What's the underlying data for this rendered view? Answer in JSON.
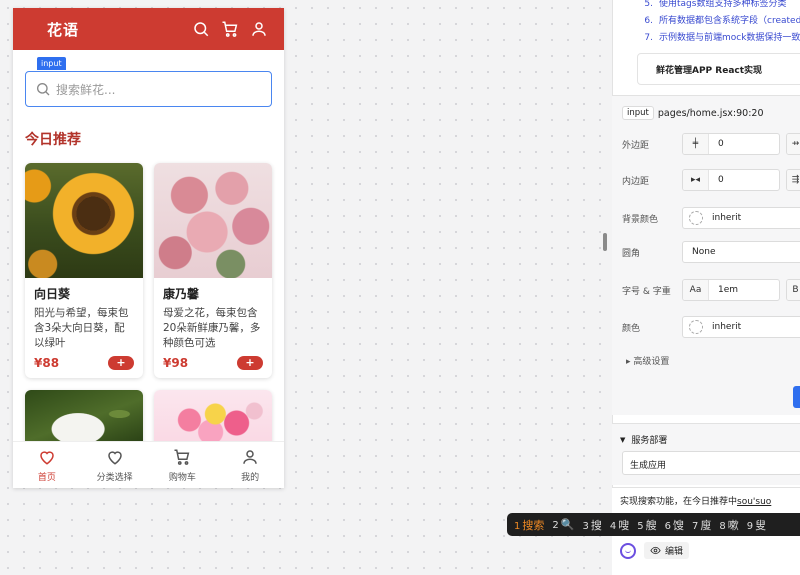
{
  "phone": {
    "app_title": "花语",
    "search": {
      "tag": "input",
      "placeholder": "搜索鲜花..."
    },
    "section_title": "今日推荐",
    "products": [
      {
        "name": "向日葵",
        "desc": "阳光与希望，每束包含3朵大向日葵，配以绿叶",
        "price": "¥88",
        "add": "+"
      },
      {
        "name": "康乃馨",
        "desc": "母爱之花，每束包含20朵新鲜康乃馨，多种颜色可选",
        "price": "¥98",
        "add": "+"
      }
    ],
    "tabs": [
      {
        "label": "首页",
        "icon": "heart-icon",
        "active": true
      },
      {
        "label": "分类选择",
        "icon": "heart-outline-icon",
        "active": false
      },
      {
        "label": "购物车",
        "icon": "cart-icon",
        "active": false
      },
      {
        "label": "我的",
        "icon": "user-icon",
        "active": false
      }
    ]
  },
  "chat": {
    "lines": [
      {
        "num": "5.",
        "text": "使用tags数组支持多种标签分类"
      },
      {
        "num": "6.",
        "text": "所有数据都包含系统字段（createdA"
      },
      {
        "num": "7.",
        "text": "示例数据与前端mock数据保持一致，"
      }
    ],
    "card_title": "鲜花管理APP React实现"
  },
  "properties": {
    "element_tag": "input",
    "element_path": "pages/home.jsx:90:20",
    "margin": {
      "label": "外边距",
      "value": "0"
    },
    "padding": {
      "label": "内边距",
      "value": "0"
    },
    "background": {
      "label": "背景颜色",
      "value": "inherit"
    },
    "radius": {
      "label": "圆角",
      "value": "None"
    },
    "font": {
      "label": "字号 & 字重",
      "icon_text": "Aa",
      "value": "1em"
    },
    "color": {
      "label": "颜色",
      "value": "inherit"
    },
    "advanced": "高级设置"
  },
  "deploy": {
    "title": "服务部署",
    "option": "生成应用"
  },
  "prompt": {
    "text_before": "实现搜索功能，在今日推荐中",
    "text_underlined": "sou'suo",
    "edit_label": "编辑"
  },
  "ime": {
    "candidates": [
      {
        "n": "1",
        "text": "搜索",
        "active": true
      },
      {
        "n": "2",
        "text": "🔍",
        "active": false
      },
      {
        "n": "3",
        "text": "搜",
        "active": false
      },
      {
        "n": "4",
        "text": "嗖",
        "active": false
      },
      {
        "n": "5",
        "text": "艘",
        "active": false
      },
      {
        "n": "6",
        "text": "馊",
        "active": false
      },
      {
        "n": "7",
        "text": "廋",
        "active": false
      },
      {
        "n": "8",
        "text": "嗽",
        "active": false
      },
      {
        "n": "9",
        "text": "叟",
        "active": false
      }
    ]
  },
  "colors": {
    "brand": "#cd3b31",
    "select": "#2f6fef",
    "link": "#3a4bd0"
  }
}
